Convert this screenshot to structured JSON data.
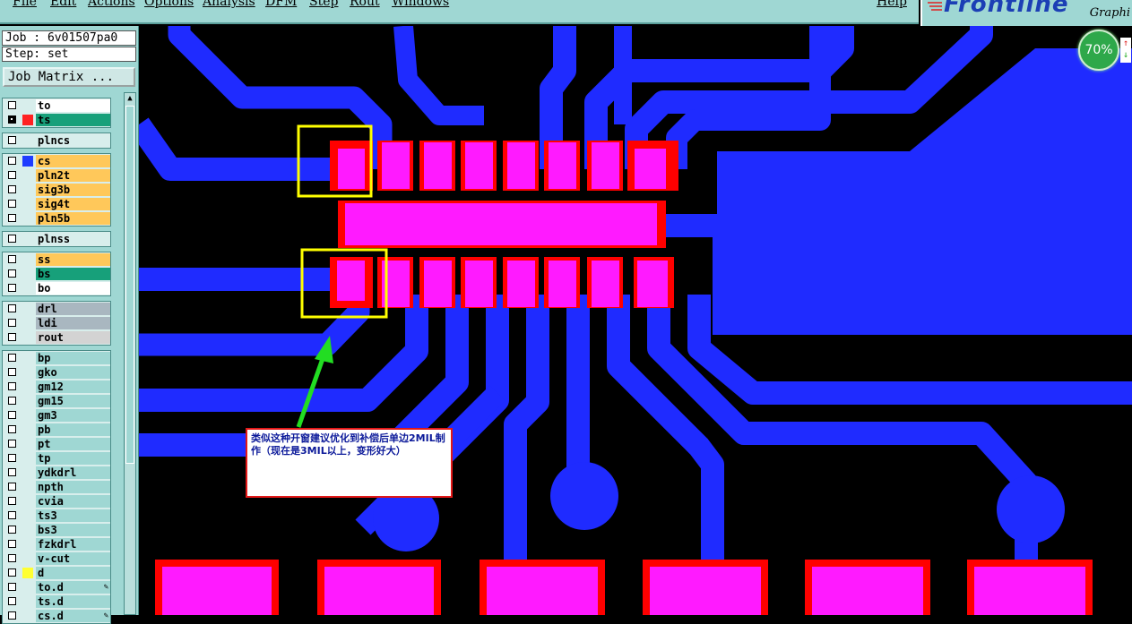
{
  "menu": {
    "items": [
      "File",
      "Edit",
      "Actions",
      "Options",
      "Analysis",
      "DFM",
      "Step",
      "Rout",
      "Windows"
    ],
    "help": "Help"
  },
  "logo": {
    "text": "Frontline",
    "sub": "Graphi"
  },
  "job": {
    "job_label": "Job : 6v01507pa0",
    "step_label": "Step: set",
    "matrix_button": "Job Matrix ..."
  },
  "layers": [
    {
      "name": "to",
      "color": "#ffffff",
      "selected": false
    },
    {
      "name": "ts",
      "color": "#17a07a",
      "selected": true,
      "dot": "#ff2222"
    },
    {
      "name": "plncs",
      "color": "#d8eeec",
      "selected": false
    },
    {
      "name": "cs",
      "color": "#ffc85a",
      "selected": false,
      "dot": "#1f3cff"
    },
    {
      "name": "pln2t",
      "color": "#ffc85a",
      "selected": false
    },
    {
      "name": "sig3b",
      "color": "#ffc85a",
      "selected": false
    },
    {
      "name": "sig4t",
      "color": "#ffc85a",
      "selected": false
    },
    {
      "name": "pln5b",
      "color": "#ffc85a",
      "selected": false
    },
    {
      "name": "plnss",
      "color": "#d8eeec",
      "selected": false
    },
    {
      "name": "ss",
      "color": "#ffc85a",
      "selected": false
    },
    {
      "name": "bs",
      "color": "#17a07a",
      "selected": false
    },
    {
      "name": "bo",
      "color": "#ffffff",
      "selected": false
    },
    {
      "name": "drl",
      "color": "#a9b7c0",
      "selected": false
    },
    {
      "name": "ldi",
      "color": "#a9b7c0",
      "selected": false
    },
    {
      "name": "rout",
      "color": "#d3d3d3",
      "selected": false
    },
    {
      "name": "bp",
      "color": "#9fd7d3",
      "selected": false
    },
    {
      "name": "gko",
      "color": "#9fd7d3",
      "selected": false
    },
    {
      "name": "gm12",
      "color": "#9fd7d3",
      "selected": false
    },
    {
      "name": "gm15",
      "color": "#9fd7d3",
      "selected": false
    },
    {
      "name": "gm3",
      "color": "#9fd7d3",
      "selected": false
    },
    {
      "name": "pb",
      "color": "#9fd7d3",
      "selected": false
    },
    {
      "name": "pt",
      "color": "#9fd7d3",
      "selected": false
    },
    {
      "name": "tp",
      "color": "#9fd7d3",
      "selected": false
    },
    {
      "name": "ydkdrl",
      "color": "#9fd7d3",
      "selected": false
    },
    {
      "name": "npth",
      "color": "#9fd7d3",
      "selected": false
    },
    {
      "name": "cvia",
      "color": "#9fd7d3",
      "selected": false
    },
    {
      "name": "ts3",
      "color": "#9fd7d3",
      "selected": false
    },
    {
      "name": "bs3",
      "color": "#9fd7d3",
      "selected": false
    },
    {
      "name": "fzkdrl",
      "color": "#9fd7d3",
      "selected": false
    },
    {
      "name": "v-cut",
      "color": "#9fd7d3",
      "selected": false
    },
    {
      "name": "d",
      "color": "#9fd7d3",
      "selected": false,
      "dot": "#ffff33"
    },
    {
      "name": "to.d",
      "color": "#9fd7d3",
      "selected": false,
      "mark": "✎"
    },
    {
      "name": "ts.d",
      "color": "#9fd7d3",
      "selected": false
    },
    {
      "name": "cs.d",
      "color": "#9fd7d3",
      "selected": false,
      "mark": "✎"
    }
  ],
  "zoom": {
    "label": "70%",
    "up": "↑",
    "down": "↓"
  },
  "annotation": {
    "text": "类似这种开窗建议优化到补偿后单边2MIL制作（现在是3MIL以上，变形好大）"
  },
  "colors": {
    "copper": "#1f2bff",
    "pad": "#ff1aff",
    "mask": "#ff0000",
    "highlight": "#ffff00",
    "arrow": "#22dd22",
    "panel": "#9fd7d3"
  }
}
